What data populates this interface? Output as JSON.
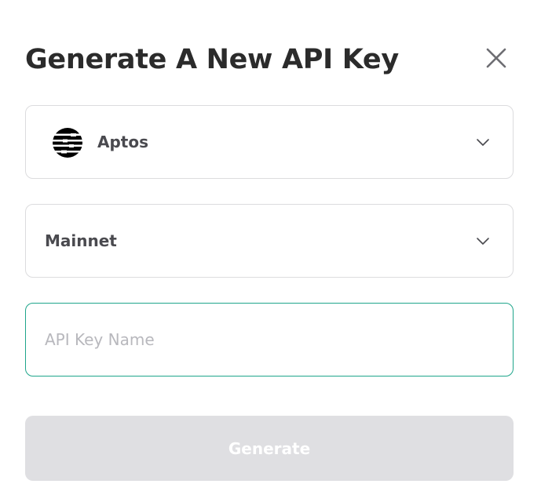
{
  "dialog": {
    "title": "Generate A New API Key"
  },
  "chain_select": {
    "selected": "Aptos",
    "icon": "aptos-logo-icon"
  },
  "network_select": {
    "selected": "Mainnet"
  },
  "key_name_input": {
    "value": "",
    "placeholder": "API Key Name",
    "focus_border_color": "#1fa58b"
  },
  "generate_button": {
    "label": "Generate",
    "disabled": true,
    "background": "#dfdfe2"
  }
}
